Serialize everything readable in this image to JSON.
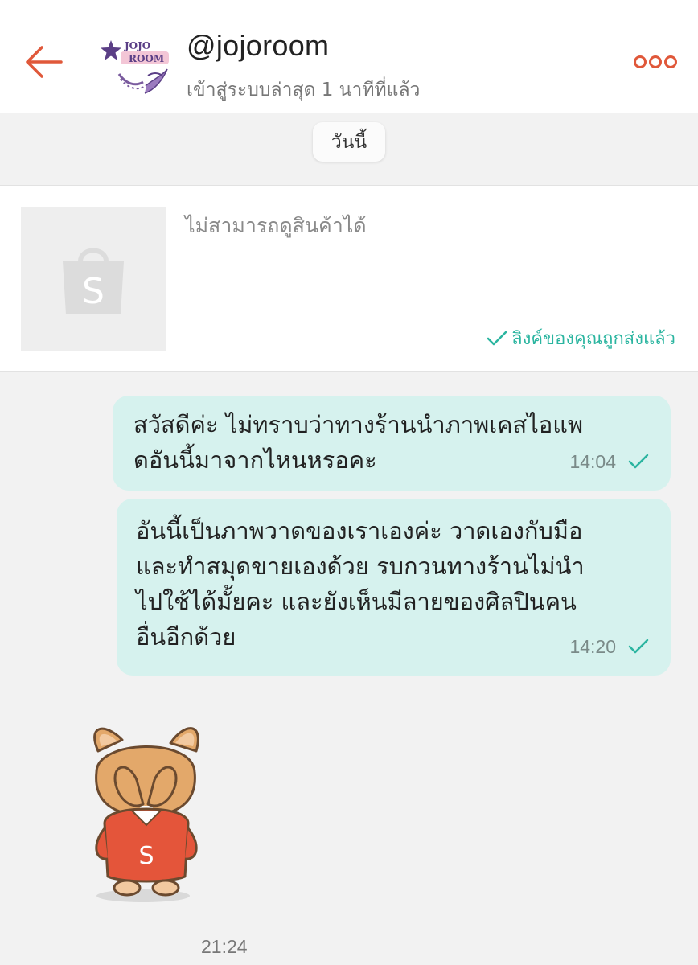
{
  "header": {
    "username": "@jojoroom",
    "last_seen": "เข้าสู่ระบบล่าสุด 1 นาทีที่แล้ว",
    "avatar_text_top": "JOJO",
    "avatar_text_bottom": "ROOM",
    "back_icon": "arrow-left-icon",
    "more_icon": "more-dots-icon",
    "accent_color": "#e0583a"
  },
  "date_chip": "วันนี้",
  "product_card": {
    "title": "ไม่สามารถดูสินค้าได้",
    "thumbnail_icon": "shopping-bag-icon",
    "thumbnail_letter": "S",
    "link_status": "ลิงค์ของคุณถูกส่งแล้ว",
    "link_status_color": "#2bb5a0"
  },
  "messages": [
    {
      "lines": [
        "สวัสดีค่ะ ไม่ทราบว่าทางร้านนำภาพเคสไอแพ",
        "ดอันนี้มาจากไหนหรอคะ"
      ],
      "time": "14:04",
      "status_icon": "check-icon"
    },
    {
      "lines": [
        "อันนี้เป็นภาพวาดของเราเองค่ะ วาดเองกับมือ",
        "และทำสมุดขายเองด้วย รบกวนทางร้านไม่นำ",
        "ไปใช้ได้มั้ยคะ และยังเห็นมีลายของศิลปินคน",
        "อื่นอีกด้วย"
      ],
      "time": "14:20",
      "status_icon": "check-icon"
    }
  ],
  "sticker": {
    "icon": "corgi-sticker-icon",
    "shirt_letter": "S",
    "time": "21:24"
  },
  "colors": {
    "bubble": "#d6f2ee",
    "background": "#f2f2f2",
    "check": "#2bb5a0"
  }
}
